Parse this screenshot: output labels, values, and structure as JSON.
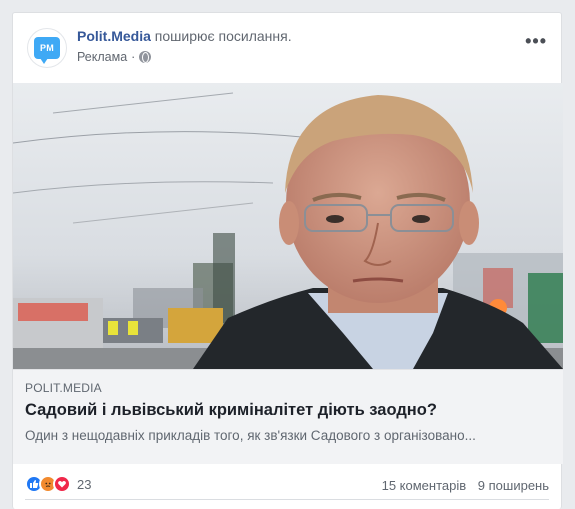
{
  "post": {
    "avatar_text": "PM",
    "page_name": "Polit.Media",
    "action_text": "поширює посилання.",
    "sponsored": "Реклама",
    "more_icon": "ellipsis-icon",
    "privacy_icon": "globe-icon"
  },
  "link": {
    "domain": "POLIT.MEDIA",
    "headline": "Садовий і львівський криміналітет діють заодно?",
    "description": "Один з нещодавніх прикладів того, як зв'язки Садового з організовано..."
  },
  "footer": {
    "reactions": [
      "like-icon",
      "angry-icon",
      "love-icon"
    ],
    "reaction_count": "23",
    "comments": "15 коментарів",
    "shares": "9 поширень"
  },
  "colors": {
    "link_blue": "#365899",
    "avatar_blue": "#3fa9f5",
    "like_blue": "#2078f4",
    "love_red": "#f0284a",
    "angry_orange": "#f28a2e"
  }
}
